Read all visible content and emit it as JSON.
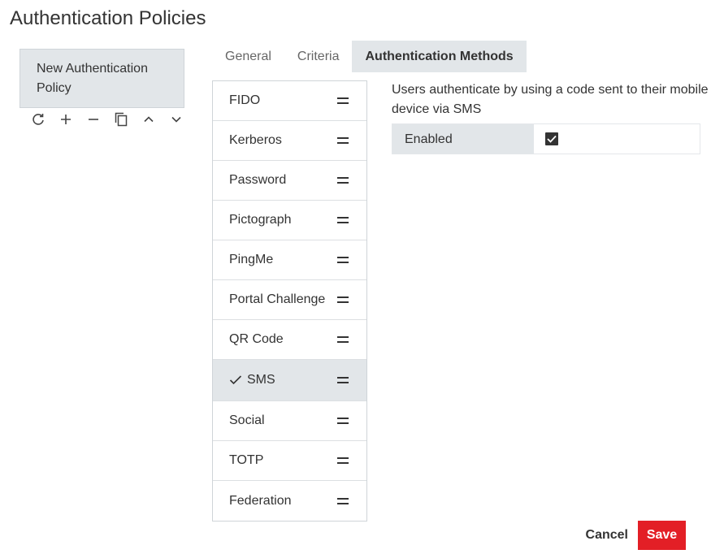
{
  "page": {
    "title": "Authentication Policies"
  },
  "policy": {
    "name": "New Authentication Policy",
    "toolbar": [
      {
        "icon": "refresh-icon"
      },
      {
        "icon": "plus-icon"
      },
      {
        "icon": "minus-icon"
      },
      {
        "icon": "copy-icon"
      },
      {
        "icon": "chevron-up-icon"
      },
      {
        "icon": "chevron-down-icon"
      }
    ]
  },
  "tabs": [
    {
      "label": "General",
      "active": false
    },
    {
      "label": "Criteria",
      "active": false
    },
    {
      "label": "Authentication Methods",
      "active": true
    }
  ],
  "methods": [
    {
      "label": "FIDO",
      "selected": false
    },
    {
      "label": "Kerberos",
      "selected": false
    },
    {
      "label": "Password",
      "selected": false
    },
    {
      "label": "Pictograph",
      "selected": false
    },
    {
      "label": "PingMe",
      "selected": false
    },
    {
      "label": "Portal Challenge",
      "selected": false
    },
    {
      "label": "QR Code",
      "selected": false
    },
    {
      "label": "SMS",
      "selected": true
    },
    {
      "label": "Social",
      "selected": false
    },
    {
      "label": "TOTP",
      "selected": false
    },
    {
      "label": "Federation",
      "selected": false
    }
  ],
  "detail": {
    "description": "Users authenticate by using a code sent to their mobile device via SMS",
    "enabled_label": "Enabled",
    "enabled": true
  },
  "footer": {
    "cancel_label": "Cancel",
    "save_label": "Save"
  },
  "colors": {
    "accent": "#e31f26",
    "selected_bg": "#e2e6e9",
    "text": "#333333"
  }
}
